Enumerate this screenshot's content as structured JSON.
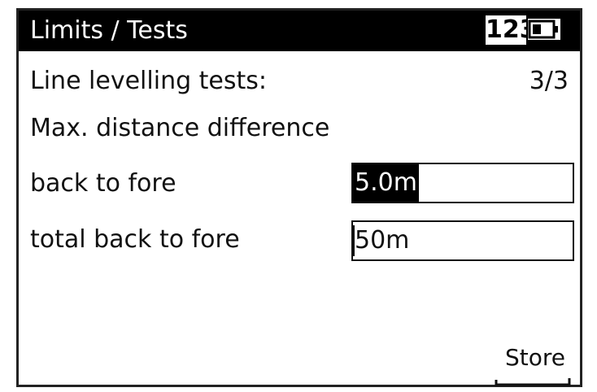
{
  "header": {
    "title": "Limits / Tests",
    "mode": "123",
    "battery_icon": "battery-icon"
  },
  "rows": {
    "line_levelling_label": "Line levelling tests:",
    "line_levelling_value": "3/3",
    "max_distance_label": "Max. distance difference",
    "back_to_fore_label": "back to fore",
    "back_to_fore_value": "5.0m",
    "total_back_to_fore_label": "total back to fore",
    "total_back_to_fore_value": "50m"
  },
  "softkeys": {
    "store_label": "Store"
  }
}
